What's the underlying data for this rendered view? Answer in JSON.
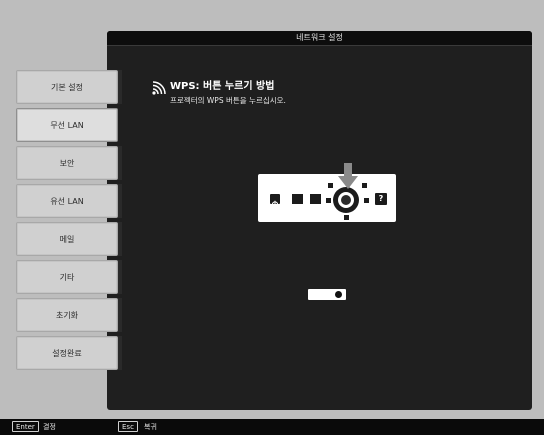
{
  "panel": {
    "title": "네트워크 설정"
  },
  "sidebar": {
    "items": [
      {
        "label": "기본 설정",
        "selected": false
      },
      {
        "label": "무선 LAN",
        "selected": true
      },
      {
        "label": "보안",
        "selected": false
      },
      {
        "label": "유선 LAN",
        "selected": false
      },
      {
        "label": "메일",
        "selected": false
      },
      {
        "label": "기타",
        "selected": false
      },
      {
        "label": "초기화",
        "selected": false
      },
      {
        "label": "설정완료",
        "selected": false
      }
    ]
  },
  "content": {
    "title": "WPS: 버튼 누르기 방법",
    "description": "프로젝터의 WPS 버튼을 누르십시오.",
    "help_glyph": "?"
  },
  "footer": {
    "enter_key": "Enter",
    "enter_label": "결정",
    "esc_key": "Esc",
    "esc_label": "복귀"
  },
  "icons": {
    "wps": "wireless-signal-icon",
    "power": "power-icon",
    "arrow": "down-arrow-icon",
    "help": "help-icon"
  }
}
